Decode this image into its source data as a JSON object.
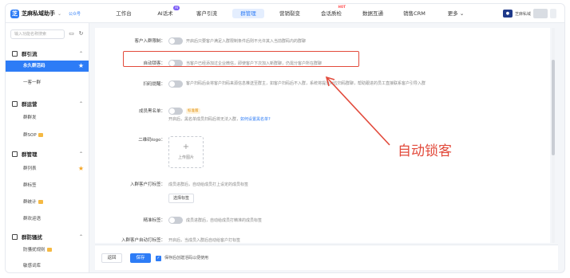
{
  "app": {
    "name": "芝麻私域助手",
    "tag": "公众号",
    "user_name": "芝麻私域"
  },
  "nav": [
    {
      "label": "工作台"
    },
    {
      "label": "AI话术",
      "badge": "AI"
    },
    {
      "label": "客户引流"
    },
    {
      "label": "群管理",
      "active": true
    },
    {
      "label": "营销裂变"
    },
    {
      "label": "会话质检",
      "badge": "HOT"
    },
    {
      "label": "数据互通"
    },
    {
      "label": "销售CRM"
    },
    {
      "label": "更多"
    }
  ],
  "sidebar": {
    "search_placeholder": "输入功能名称搜索",
    "groups": [
      {
        "label": "群引流",
        "items": [
          {
            "label": "永久群活码",
            "active": true,
            "star": true
          },
          {
            "label": "一客一群"
          }
        ]
      },
      {
        "label": "群运营",
        "items": [
          {
            "label": "群群发"
          },
          {
            "label": "群SOP",
            "vip": true
          }
        ]
      },
      {
        "label": "群管理",
        "items": [
          {
            "label": "群列表",
            "star": true
          },
          {
            "label": "群标签"
          },
          {
            "label": "群统计",
            "vip": true
          },
          {
            "label": "群欢迎语"
          }
        ]
      },
      {
        "label": "群防骚扰",
        "items": [
          {
            "label": "防骚扰规则",
            "vip": true
          },
          {
            "label": "敏感词库"
          }
        ]
      }
    ]
  },
  "form": {
    "rows": [
      {
        "key": "join_limit",
        "label": "客户入群限制：",
        "desc": "开启后只要客户满足入群限制条件后则不允许其入当前群码内的群聊"
      },
      {
        "key": "auto_lock",
        "label": "自动锁客：",
        "desc": "当客户已经添加过企业微信，即使客户下次加入新群聊，仍需分客户所在群聊"
      },
      {
        "key": "scan_notify",
        "label": "扫码提醒：",
        "desc": "客户扫码后会将客户扫码来源信息推送至群主，如客户扫码后不入群，系统将提示对应扫码群聊，帮助跟进的员工直接联系客户引导入群"
      },
      {
        "key": "blacklist",
        "label": "成员黑名单：",
        "vip_label": "标准版",
        "desc": "开启后，黑名单成员扫码后将无法入群，",
        "link": "如何设置黑名单?"
      },
      {
        "key": "qr_logo",
        "label": "二维码logo：",
        "upload_label": "上传图片"
      },
      {
        "key": "join_tag",
        "label": "入群客户打标签：",
        "desc": "成员进群后，自动给成员打上设定的成员标签",
        "button": "选择标签"
      },
      {
        "key": "exact_tag",
        "label": "精准标签：",
        "desc": "成员进群后，自动给成员打精准的成员标签"
      },
      {
        "key": "more",
        "label": "入群客户自动打标签：",
        "desc": "开启后，当成员入群后自动给客户打标签"
      }
    ]
  },
  "annotation": {
    "text": "自动锁客",
    "color": "#e24a3b"
  },
  "bottom": {
    "back_label": "返回",
    "save_label": "保存",
    "checkbox_label": "保存后创建活码以便使用"
  },
  "colors": {
    "accent": "#2d7cf6",
    "highlight": "#e24a3b"
  }
}
